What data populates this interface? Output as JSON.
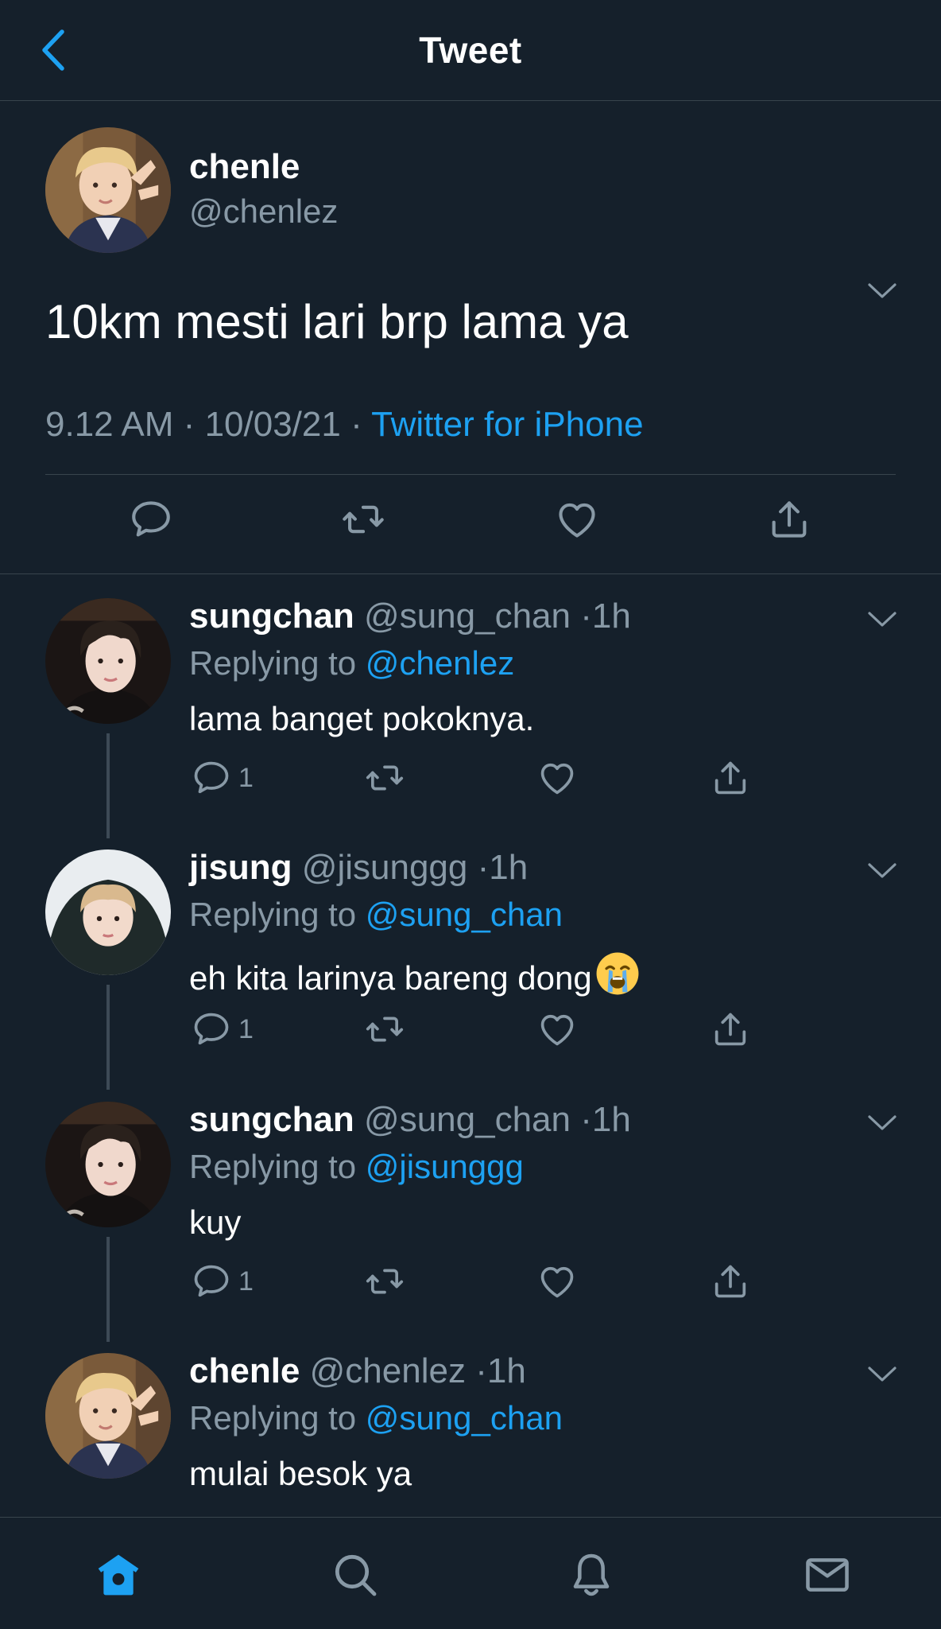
{
  "header": {
    "title": "Tweet"
  },
  "main_tweet": {
    "name": "chenle",
    "handle": "@chenlez",
    "text": "10km mesti lari brp lama ya",
    "time": "9.12 AM",
    "date": "10/03/21",
    "source": "Twitter for iPhone"
  },
  "replies": [
    {
      "name": "sungchan",
      "handle": "@sung_chan",
      "time": "1h",
      "replying_label": "Replying to",
      "replying_to": "@chenlez",
      "text": "lama banget pokoknya.",
      "reply_count": "1"
    },
    {
      "name": "jisung",
      "handle": "@jisunggg",
      "time": "1h",
      "replying_label": "Replying to",
      "replying_to": "@sung_chan",
      "text": "eh kita larinya bareng dong",
      "emoji": "loudly-crying-face",
      "reply_count": "1"
    },
    {
      "name": "sungchan",
      "handle": "@sung_chan",
      "time": "1h",
      "replying_label": "Replying to",
      "replying_to": "@jisunggg",
      "text": "kuy",
      "reply_count": "1"
    },
    {
      "name": "chenle",
      "handle": "@chenlez",
      "time": "1h",
      "replying_label": "Replying to",
      "replying_to": "@sung_chan",
      "text": "mulai besok ya"
    }
  ],
  "colors": {
    "background": "#15202b",
    "accent": "#1da1f2",
    "muted": "#8899a6",
    "divider": "#38444d"
  },
  "icons": {
    "nav": [
      "home-icon",
      "search-icon",
      "bell-icon",
      "mail-icon"
    ],
    "actions": [
      "reply-icon",
      "retweet-icon",
      "like-icon",
      "share-icon"
    ]
  }
}
